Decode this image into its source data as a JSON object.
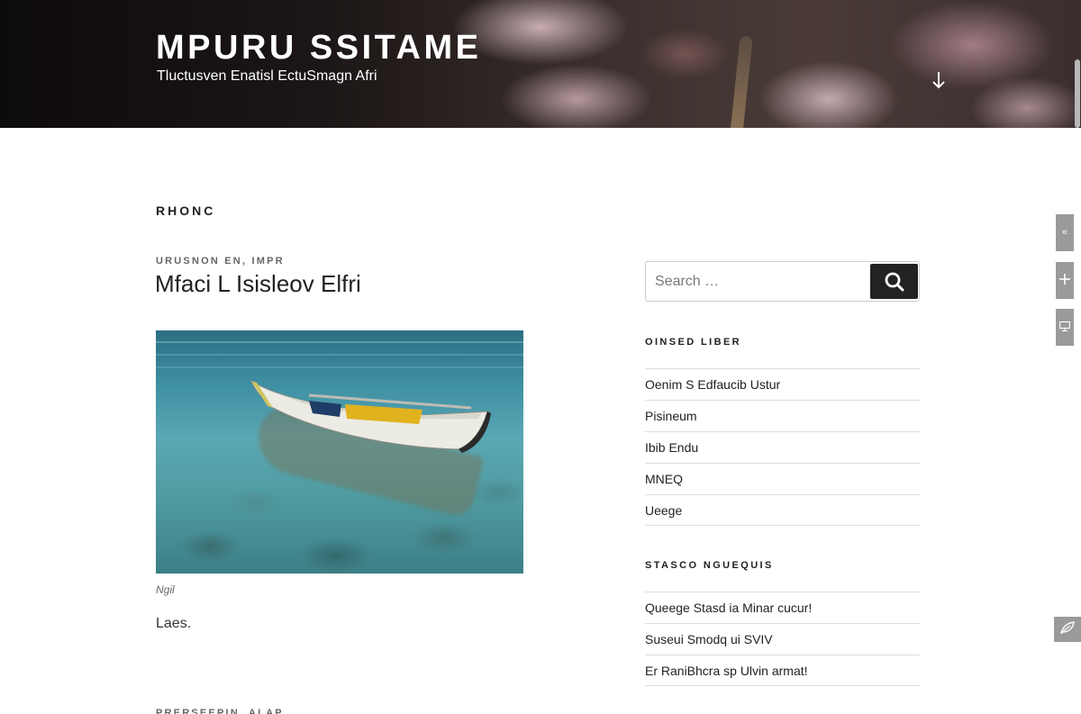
{
  "header": {
    "site_title": "MPURU SSITAME",
    "tagline": "Tluctusven Enatisl EctuSmagn Afri",
    "scroll_icon": "arrow-down-icon"
  },
  "main": {
    "page_heading": "RHONC",
    "post": {
      "categories": "URUSNON EN, IMPR",
      "title": "Mfaci L Isisleov Elfri",
      "image_caption": "Ngil",
      "body": "Laes.",
      "image_subject": "rowboat on clear water"
    },
    "next_post_meta": "PRERSEEPIN, ALAP"
  },
  "sidebar": {
    "search": {
      "placeholder": "Search …",
      "value": "",
      "button_icon": "search-icon"
    },
    "widget1": {
      "title": "OINSED LIBER",
      "items": [
        "Oenim S Edfaucib Ustur",
        "Pisineum",
        "Ibib Endu",
        "MNEQ",
        "Ueege"
      ]
    },
    "widget2": {
      "title": "STASCO NGUEQUIS",
      "items": [
        "Queege Stasd ia Minar cucur!",
        "Suseui Smodq ui SVIV",
        "Er RaniBhcra sp Ulvin armat!"
      ]
    }
  },
  "edge_tools": {
    "icons": [
      "collapse-icon",
      "move-icon",
      "desktop-icon",
      "leaf-icon"
    ]
  },
  "colors": {
    "search_button": "#222222",
    "divider": "#dddddd",
    "edge_tab": "#9a9a9a"
  }
}
